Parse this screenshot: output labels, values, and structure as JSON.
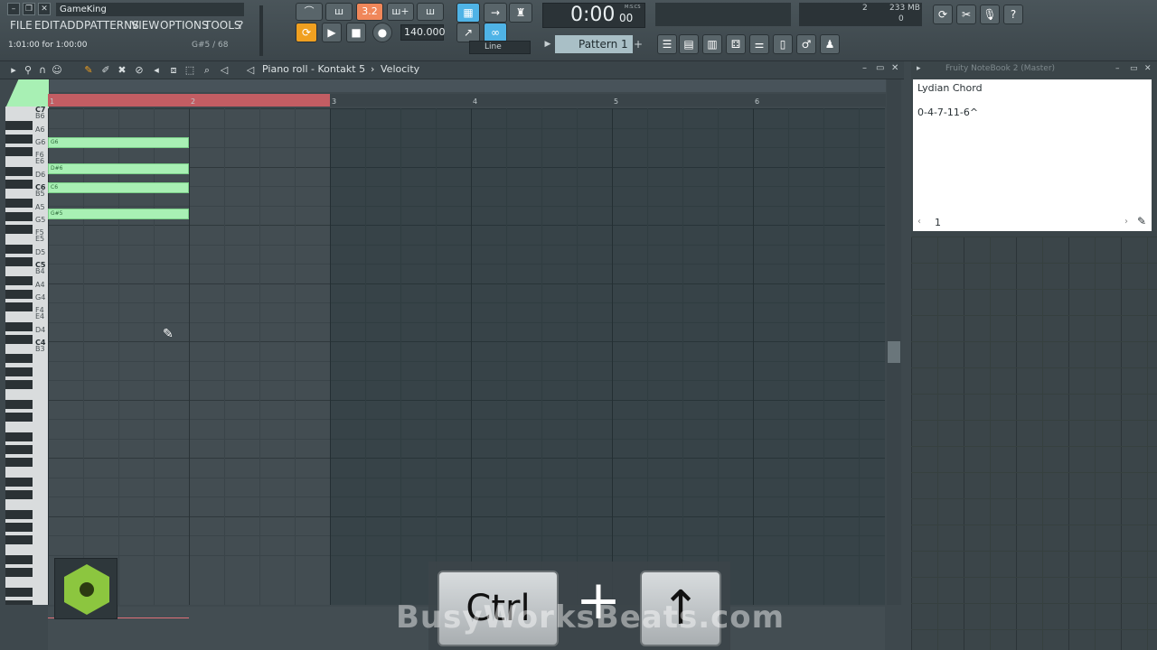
{
  "app": {
    "title": "GameKing",
    "hint": "1:01:00 for 1:00:00",
    "note_info": "G#5 / 68"
  },
  "menu": [
    "FILE",
    "EDIT",
    "ADD",
    "PATTERNS",
    "VIEW",
    "OPTIONS",
    "TOOLS",
    "?"
  ],
  "transport": {
    "time": "0:00",
    "time_small": "00",
    "time_label": "M:S:CS",
    "tempo": "140.000",
    "pattern": "Pattern 1",
    "snap_label": "Line"
  },
  "stats": {
    "cpu": "2",
    "memory": "233 MB",
    "voices": "0"
  },
  "pianoroll": {
    "title": "Piano roll - Kontakt 5",
    "separator": "›",
    "target": "Velocity",
    "bars": [
      "1",
      "2",
      "3",
      "4",
      "5",
      "6"
    ]
  },
  "keys": {
    "labels": [
      "C7",
      "B6",
      "A6",
      "G6",
      "F6",
      "E6",
      "D6",
      "C6",
      "B5",
      "A5",
      "G5",
      "F5",
      "E5",
      "D5",
      "C5",
      "B4",
      "A4",
      "G4",
      "F4",
      "E4",
      "D4",
      "C4",
      "B3"
    ]
  },
  "notes": [
    {
      "label": "G6",
      "pitch": "G6",
      "start_beat": 0,
      "length_beats": 4
    },
    {
      "label": "D#6",
      "pitch": "D#6",
      "start_beat": 0,
      "length_beats": 4
    },
    {
      "label": "C6",
      "pitch": "C6",
      "start_beat": 0,
      "length_beats": 4
    },
    {
      "label": "G#5",
      "pitch": "G#5",
      "start_beat": 0,
      "length_beats": 4
    }
  ],
  "notebook": {
    "title": "Fruity NoteBook 2 (Master)",
    "line1": "Lydian Chord",
    "line2": "0-4-7-11-6^",
    "page": "1"
  },
  "overlay": {
    "key1": "Ctrl",
    "plus": "+",
    "key2": "↑",
    "watermark": "BusyWorksBeats.com"
  },
  "colors": {
    "note": "#a8f0b4",
    "accent": "#f0875a",
    "loop_region": "#c35d63"
  }
}
